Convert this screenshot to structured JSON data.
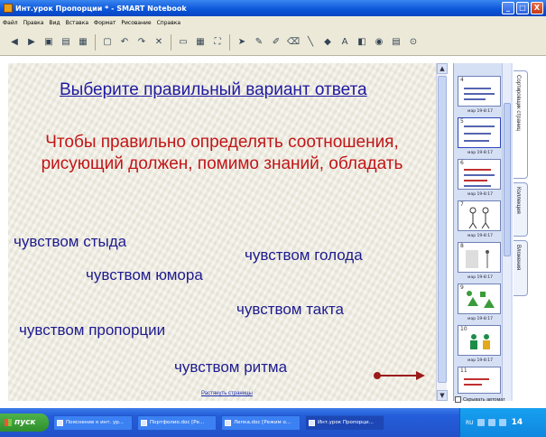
{
  "window": {
    "title": "Инт.урок Пропорции * - SMART Notebook",
    "buttons": {
      "minimize": "_",
      "maximize": "□",
      "close": "X"
    }
  },
  "menu": [
    "Файл",
    "Правка",
    "Вид",
    "Вставка",
    "Формат",
    "Рисование",
    "Справка"
  ],
  "toolbar": {
    "icons": [
      "back-icon",
      "forward-icon",
      "add-page-icon",
      "open-icon",
      "save-icon",
      "paste-icon",
      "undo-icon",
      "redo-icon",
      "delete-icon",
      "screen-shade-icon",
      "table-icon",
      "full-screen-icon",
      "select-icon",
      "pen-icon",
      "creative-pen-icon",
      "eraser-icon",
      "line-icon",
      "shape-icon",
      "text-icon",
      "fill-icon",
      "properties-icon",
      "capture-icon",
      "more-icon"
    ],
    "text_tool": "A"
  },
  "slide": {
    "title": "Выберите правильный вариант ответа",
    "sentence": "Чтобы правильно определять соотношения, рисующий должен, помимо знаний, обладать",
    "answers": [
      "чувством стыда",
      "чувством голода",
      "чувством юмора",
      "чувством такта",
      "чувством пропорции",
      "чувством ритма"
    ],
    "zoom_link": "Растянуть страницы",
    "arrow_color": "#9b1b1b",
    "title_color": "#1f1aa0",
    "sentence_color": "#c21517",
    "answer_color": "#1e1b8f"
  },
  "sidebar": {
    "pages": [
      {
        "number": "4",
        "date": "мар 19-8:17"
      },
      {
        "number": "5",
        "date": "мар 19-8:17"
      },
      {
        "number": "6",
        "date": "мар 19-8:17"
      },
      {
        "number": "7",
        "date": "мар 19-8:17"
      },
      {
        "number": "8",
        "date": "мар 19-8:17"
      },
      {
        "number": "9",
        "date": "мар 19-8:17"
      },
      {
        "number": "10",
        "date": "мар 19-8:17"
      },
      {
        "number": "11",
        "date": ""
      }
    ],
    "autohide_label": "Скрывать автомат",
    "tabs": [
      "Сортировщик страниц",
      "Коллекция",
      "Вложения"
    ]
  },
  "taskbar": {
    "start_label": "пуск",
    "tasks": [
      "Пояснение к инт. ур...",
      "Портфолио.doc [Ре...",
      "Лепка.doc [Режим о...",
      "Инт.урок Пропорци..."
    ],
    "lang": "RU",
    "clock": "14"
  }
}
